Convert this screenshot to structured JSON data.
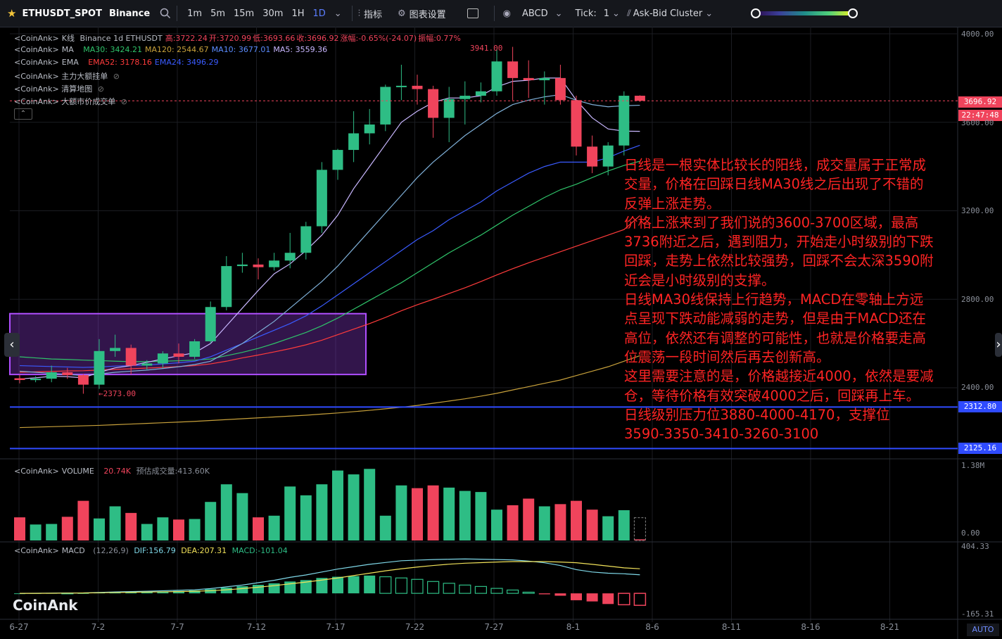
{
  "toolbar": {
    "symbol": "ETHUSDT_SPOT",
    "exchange": "Binance",
    "timeframes": [
      "1m",
      "5m",
      "15m",
      "30m",
      "1H",
      "1D"
    ],
    "active_timeframe": "1D",
    "indicators_label": "指标",
    "chart_settings_label": "图表设置",
    "abcd_label": "ABCD",
    "tick_label": "Tick:",
    "tick_value": "1",
    "cluster_label": "Ask-Bid Cluster"
  },
  "legend": {
    "kline": {
      "prefix": "<CoinAnk>",
      "name": "K线",
      "meta": "Binance 1d ETHUSDT",
      "high": "高:3722.24",
      "open": "开:3720.99",
      "low": "低:3693.66",
      "close": "收:3696.92",
      "change": "涨幅:-0.65%(-24.07)",
      "amp": "振幅:0.77%"
    },
    "ma": {
      "prefix": "<CoinAnk>",
      "name": "MA",
      "items": [
        {
          "text": "MA30: 3424.21",
          "color": "#2fc46a"
        },
        {
          "text": "MA120: 2544.67",
          "color": "#c8a13b"
        },
        {
          "text": "MA10: 3677.01",
          "color": "#5b8cff"
        },
        {
          "text": "MA5: 3559.36",
          "color": "#c9b7ff"
        }
      ]
    },
    "ema": {
      "prefix": "<CoinAnk>",
      "name": "EMA",
      "items": [
        {
          "text": "EMA52: 3178.16",
          "color": "#ff3b3b"
        },
        {
          "text": "EMA24: 3496.29",
          "color": "#3a5bff"
        }
      ]
    },
    "rows": [
      "<CoinAnk> 主力大额挂单",
      "<CoinAnk> 清算地图",
      "<CoinAnk> 大额市价成交单"
    ]
  },
  "annotation_lines": [
    "日线是一根实体比较长的阳线，成交量属于正常成",
    "交量，价格在回踩日线MA30线之后出现了不错的",
    "反弹上涨走势。",
    "价格上涨来到了我们说的3600-3700区域，最高",
    "3736附近之后，遇到阻力，开始走小时级别的下跌",
    "回踩，走势上依然比较强势，回踩不会太深3590附",
    "近会是小时级别的支撑。",
    "日线MA30线保持上行趋势，MACD在零轴上方远",
    "点呈现下跌动能减弱的走势，但是由于MACD还在",
    "高位，依然还有调整的可能性，也就是价格要走高",
    "位震荡一段时间然后再去创新高。",
    "这里需要注意的是，价格越接近4000，依然是要减",
    "仓，等待价格有效突破4000之后，回踩再上车。",
    "日线级别压力位3880-4000-4170，支撑位",
    "3590-3350-3410-3260-3100"
  ],
  "price_tags": {
    "current_price": "3696.92",
    "countdown": "22:47:48",
    "level1": "2312.80",
    "level2": "2125.16",
    "high_marker": "3941.00",
    "low_marker": "2373.00"
  },
  "price_axis": [
    "4000.00",
    "3600.00",
    "3200.00",
    "2800.00",
    "2400.00"
  ],
  "volume_legend": {
    "prefix": "<CoinAnk>",
    "name": "VOLUME",
    "value": "20.74K",
    "est": "预估成交量:413.60K"
  },
  "volume_axis": [
    "1.38M",
    "0.00"
  ],
  "macd_legend": {
    "prefix": "<CoinAnk>",
    "name": "MACD",
    "params": "(12,26,9)",
    "dif": "DIF:156.79",
    "dea": "DEA:207.31",
    "macd": "MACD:-101.04"
  },
  "macd_axis": [
    "404.33",
    "-165.31"
  ],
  "x_labels": [
    "6-27",
    "7-2",
    "7-7",
    "7-12",
    "7-17",
    "7-22",
    "7-27",
    "8-1",
    "8-6",
    "8-11",
    "8-16",
    "8-21"
  ],
  "brand": "CoinAnk",
  "auto_label": "AUTO",
  "colors": {
    "up": "#2ebd85",
    "down": "#f0445c",
    "bg": "#000000",
    "grid": "#1b1d22",
    "level": "#2f4bff",
    "box": "#8e3bd6"
  },
  "chart_data": {
    "type": "candlestick",
    "title": "ETHUSDT 1d",
    "ylim": [
      2000,
      4020
    ],
    "candles": [
      {
        "d": "6-27",
        "o": 2443,
        "h": 2460,
        "l": 2420,
        "c": 2435
      },
      {
        "d": "6-28",
        "o": 2435,
        "h": 2452,
        "l": 2425,
        "c": 2441
      },
      {
        "d": "6-29",
        "o": 2441,
        "h": 2500,
        "l": 2425,
        "c": 2470
      },
      {
        "d": "6-30",
        "o": 2470,
        "h": 2490,
        "l": 2440,
        "c": 2457
      },
      {
        "d": "7-1",
        "o": 2457,
        "h": 2462,
        "l": 2373,
        "c": 2414
      },
      {
        "d": "7-2",
        "o": 2414,
        "h": 2620,
        "l": 2395,
        "c": 2566
      },
      {
        "d": "7-3",
        "o": 2566,
        "h": 2640,
        "l": 2540,
        "c": 2580
      },
      {
        "d": "7-4",
        "o": 2580,
        "h": 2595,
        "l": 2460,
        "c": 2500
      },
      {
        "d": "7-5",
        "o": 2500,
        "h": 2525,
        "l": 2480,
        "c": 2510
      },
      {
        "d": "7-6",
        "o": 2510,
        "h": 2565,
        "l": 2490,
        "c": 2555
      },
      {
        "d": "7-7",
        "o": 2555,
        "h": 2600,
        "l": 2510,
        "c": 2540
      },
      {
        "d": "7-8",
        "o": 2540,
        "h": 2620,
        "l": 2530,
        "c": 2610
      },
      {
        "d": "7-9",
        "o": 2610,
        "h": 2790,
        "l": 2600,
        "c": 2765
      },
      {
        "d": "7-10",
        "o": 2765,
        "h": 2995,
        "l": 2750,
        "c": 2950
      },
      {
        "d": "7-11",
        "o": 2950,
        "h": 3010,
        "l": 2920,
        "c": 2957
      },
      {
        "d": "7-12",
        "o": 2957,
        "h": 2985,
        "l": 2890,
        "c": 2945
      },
      {
        "d": "7-13",
        "o": 2945,
        "h": 3010,
        "l": 2930,
        "c": 2975
      },
      {
        "d": "7-14",
        "o": 2975,
        "h": 3100,
        "l": 2940,
        "c": 3010
      },
      {
        "d": "7-15",
        "o": 3010,
        "h": 3150,
        "l": 2980,
        "c": 3130
      },
      {
        "d": "7-16",
        "o": 3130,
        "h": 3420,
        "l": 3100,
        "c": 3385
      },
      {
        "d": "7-17",
        "o": 3385,
        "h": 3480,
        "l": 3340,
        "c": 3475
      },
      {
        "d": "7-18",
        "o": 3475,
        "h": 3650,
        "l": 3420,
        "c": 3550
      },
      {
        "d": "7-19",
        "o": 3550,
        "h": 3660,
        "l": 3500,
        "c": 3590
      },
      {
        "d": "7-20",
        "o": 3590,
        "h": 3770,
        "l": 3560,
        "c": 3760
      },
      {
        "d": "7-21",
        "o": 3760,
        "h": 3860,
        "l": 3700,
        "c": 3765
      },
      {
        "d": "7-22",
        "o": 3765,
        "h": 3815,
        "l": 3680,
        "c": 3750
      },
      {
        "d": "7-23",
        "o": 3750,
        "h": 3765,
        "l": 3530,
        "c": 3620
      },
      {
        "d": "7-24",
        "o": 3620,
        "h": 3760,
        "l": 3510,
        "c": 3705
      },
      {
        "d": "7-25",
        "o": 3705,
        "h": 3785,
        "l": 3590,
        "c": 3720
      },
      {
        "d": "7-26",
        "o": 3720,
        "h": 3780,
        "l": 3690,
        "c": 3740
      },
      {
        "d": "7-27",
        "o": 3740,
        "h": 3930,
        "l": 3720,
        "c": 3875
      },
      {
        "d": "7-28",
        "o": 3875,
        "h": 3941,
        "l": 3700,
        "c": 3800
      },
      {
        "d": "7-29",
        "o": 3800,
        "h": 3880,
        "l": 3710,
        "c": 3790
      },
      {
        "d": "7-30",
        "o": 3790,
        "h": 3830,
        "l": 3680,
        "c": 3800
      },
      {
        "d": "7-31",
        "o": 3800,
        "h": 3860,
        "l": 3680,
        "c": 3700
      },
      {
        "d": "8-1",
        "o": 3700,
        "h": 3720,
        "l": 3450,
        "c": 3490
      },
      {
        "d": "8-2",
        "o": 3490,
        "h": 3540,
        "l": 3370,
        "c": 3400
      },
      {
        "d": "8-3",
        "o": 3400,
        "h": 3510,
        "l": 3360,
        "c": 3495
      },
      {
        "d": "8-4",
        "o": 3495,
        "h": 3740,
        "l": 3450,
        "c": 3720
      },
      {
        "d": "8-5",
        "o": 3720,
        "h": 3722,
        "l": 3693,
        "c": 3697
      }
    ],
    "ma5": [
      2440,
      2445,
      2452,
      2450,
      2445,
      2470,
      2490,
      2500,
      2515,
      2530,
      2545,
      2558,
      2600,
      2680,
      2760,
      2840,
      2915,
      2960,
      3020,
      3090,
      3180,
      3300,
      3400,
      3500,
      3600,
      3650,
      3690,
      3710,
      3710,
      3720,
      3760,
      3785,
      3790,
      3800,
      3800,
      3700,
      3620,
      3570,
      3560,
      3559
    ],
    "ma10": [
      2475,
      2470,
      2465,
      2460,
      2455,
      2462,
      2470,
      2475,
      2480,
      2487,
      2495,
      2505,
      2520,
      2560,
      2600,
      2650,
      2700,
      2760,
      2820,
      2880,
      2950,
      3030,
      3110,
      3190,
      3270,
      3350,
      3420,
      3480,
      3540,
      3590,
      3640,
      3680,
      3700,
      3715,
      3725,
      3700,
      3680,
      3670,
      3675,
      3677
    ],
    "ma30": [
      2540,
      2535,
      2530,
      2528,
      2525,
      2523,
      2520,
      2518,
      2518,
      2520,
      2522,
      2525,
      2530,
      2545,
      2560,
      2578,
      2600,
      2625,
      2650,
      2680,
      2715,
      2755,
      2795,
      2835,
      2875,
      2920,
      2965,
      3010,
      3050,
      3090,
      3135,
      3180,
      3220,
      3260,
      3295,
      3320,
      3350,
      3380,
      3405,
      3424
    ],
    "ema52": [
      2470,
      2472,
      2474,
      2476,
      2477,
      2480,
      2483,
      2486,
      2489,
      2492,
      2496,
      2500,
      2508,
      2520,
      2535,
      2548,
      2562,
      2577,
      2594,
      2615,
      2640,
      2665,
      2690,
      2718,
      2748,
      2775,
      2800,
      2826,
      2852,
      2880,
      2910,
      2938,
      2965,
      2990,
      3015,
      3040,
      3065,
      3090,
      3115,
      3178
    ],
    "ema24": [
      2500,
      2498,
      2496,
      2494,
      2492,
      2494,
      2498,
      2500,
      2503,
      2508,
      2513,
      2520,
      2540,
      2570,
      2600,
      2630,
      2660,
      2690,
      2725,
      2770,
      2820,
      2870,
      2920,
      2970,
      3020,
      3070,
      3110,
      3160,
      3200,
      3240,
      3290,
      3330,
      3370,
      3400,
      3420,
      3420,
      3420,
      3440,
      3470,
      3496
    ],
    "ma120": [
      2220,
      2222,
      2224,
      2226,
      2228,
      2230,
      2233,
      2236,
      2239,
      2242,
      2245,
      2248,
      2252,
      2256,
      2260,
      2264,
      2268,
      2272,
      2276,
      2281,
      2286,
      2292,
      2298,
      2305,
      2312,
      2320,
      2330,
      2340,
      2350,
      2362,
      2375,
      2390,
      2405,
      2420,
      2435,
      2455,
      2475,
      2495,
      2520,
      2545
    ],
    "box": {
      "x_from": "6-27",
      "x_to": "7-19",
      "y_from": 2460,
      "y_to": 2735
    },
    "levels": [
      2312.8,
      2125.16
    ],
    "current_price": 3696.92,
    "volume": {
      "ylim": [
        0,
        1380000
      ],
      "values": [
        420000,
        290000,
        300000,
        430000,
        720000,
        400000,
        620000,
        500000,
        300000,
        420000,
        380000,
        390000,
        700000,
        1020000,
        860000,
        420000,
        450000,
        980000,
        820000,
        1020000,
        1270000,
        1200000,
        1300000,
        450000,
        1000000,
        950000,
        1000000,
        960000,
        900000,
        880000,
        560000,
        640000,
        760000,
        620000,
        660000,
        720000,
        560000,
        440000,
        550000,
        20740
      ],
      "est_last": 413600
    },
    "macd": {
      "ylim": [
        -165.31,
        404.33
      ],
      "dif": [
        0,
        1,
        2,
        3,
        4,
        8,
        12,
        15,
        18,
        22,
        26,
        30,
        40,
        55,
        70,
        90,
        110,
        135,
        155,
        180,
        205,
        225,
        245,
        260,
        275,
        280,
        285,
        288,
        290,
        288,
        285,
        282,
        272,
        258,
        235,
        200,
        180,
        170,
        165,
        156.79
      ],
      "dea": [
        0,
        0,
        1,
        2,
        3,
        5,
        7,
        9,
        11,
        13,
        15,
        18,
        22,
        30,
        40,
        52,
        65,
        80,
        95,
        112,
        130,
        150,
        170,
        190,
        207,
        222,
        235,
        246,
        254,
        259,
        264,
        268,
        268,
        268,
        264,
        258,
        245,
        230,
        215,
        207.31
      ],
      "hist": [
        0,
        2,
        3,
        2,
        2,
        6,
        9,
        11,
        13,
        16,
        20,
        25,
        35,
        48,
        60,
        72,
        85,
        100,
        112,
        130,
        140,
        145,
        150,
        140,
        130,
        118,
        100,
        85,
        70,
        58,
        42,
        28,
        10,
        -8,
        -20,
        -58,
        -68,
        -90,
        -96,
        -101.04
      ]
    }
  }
}
